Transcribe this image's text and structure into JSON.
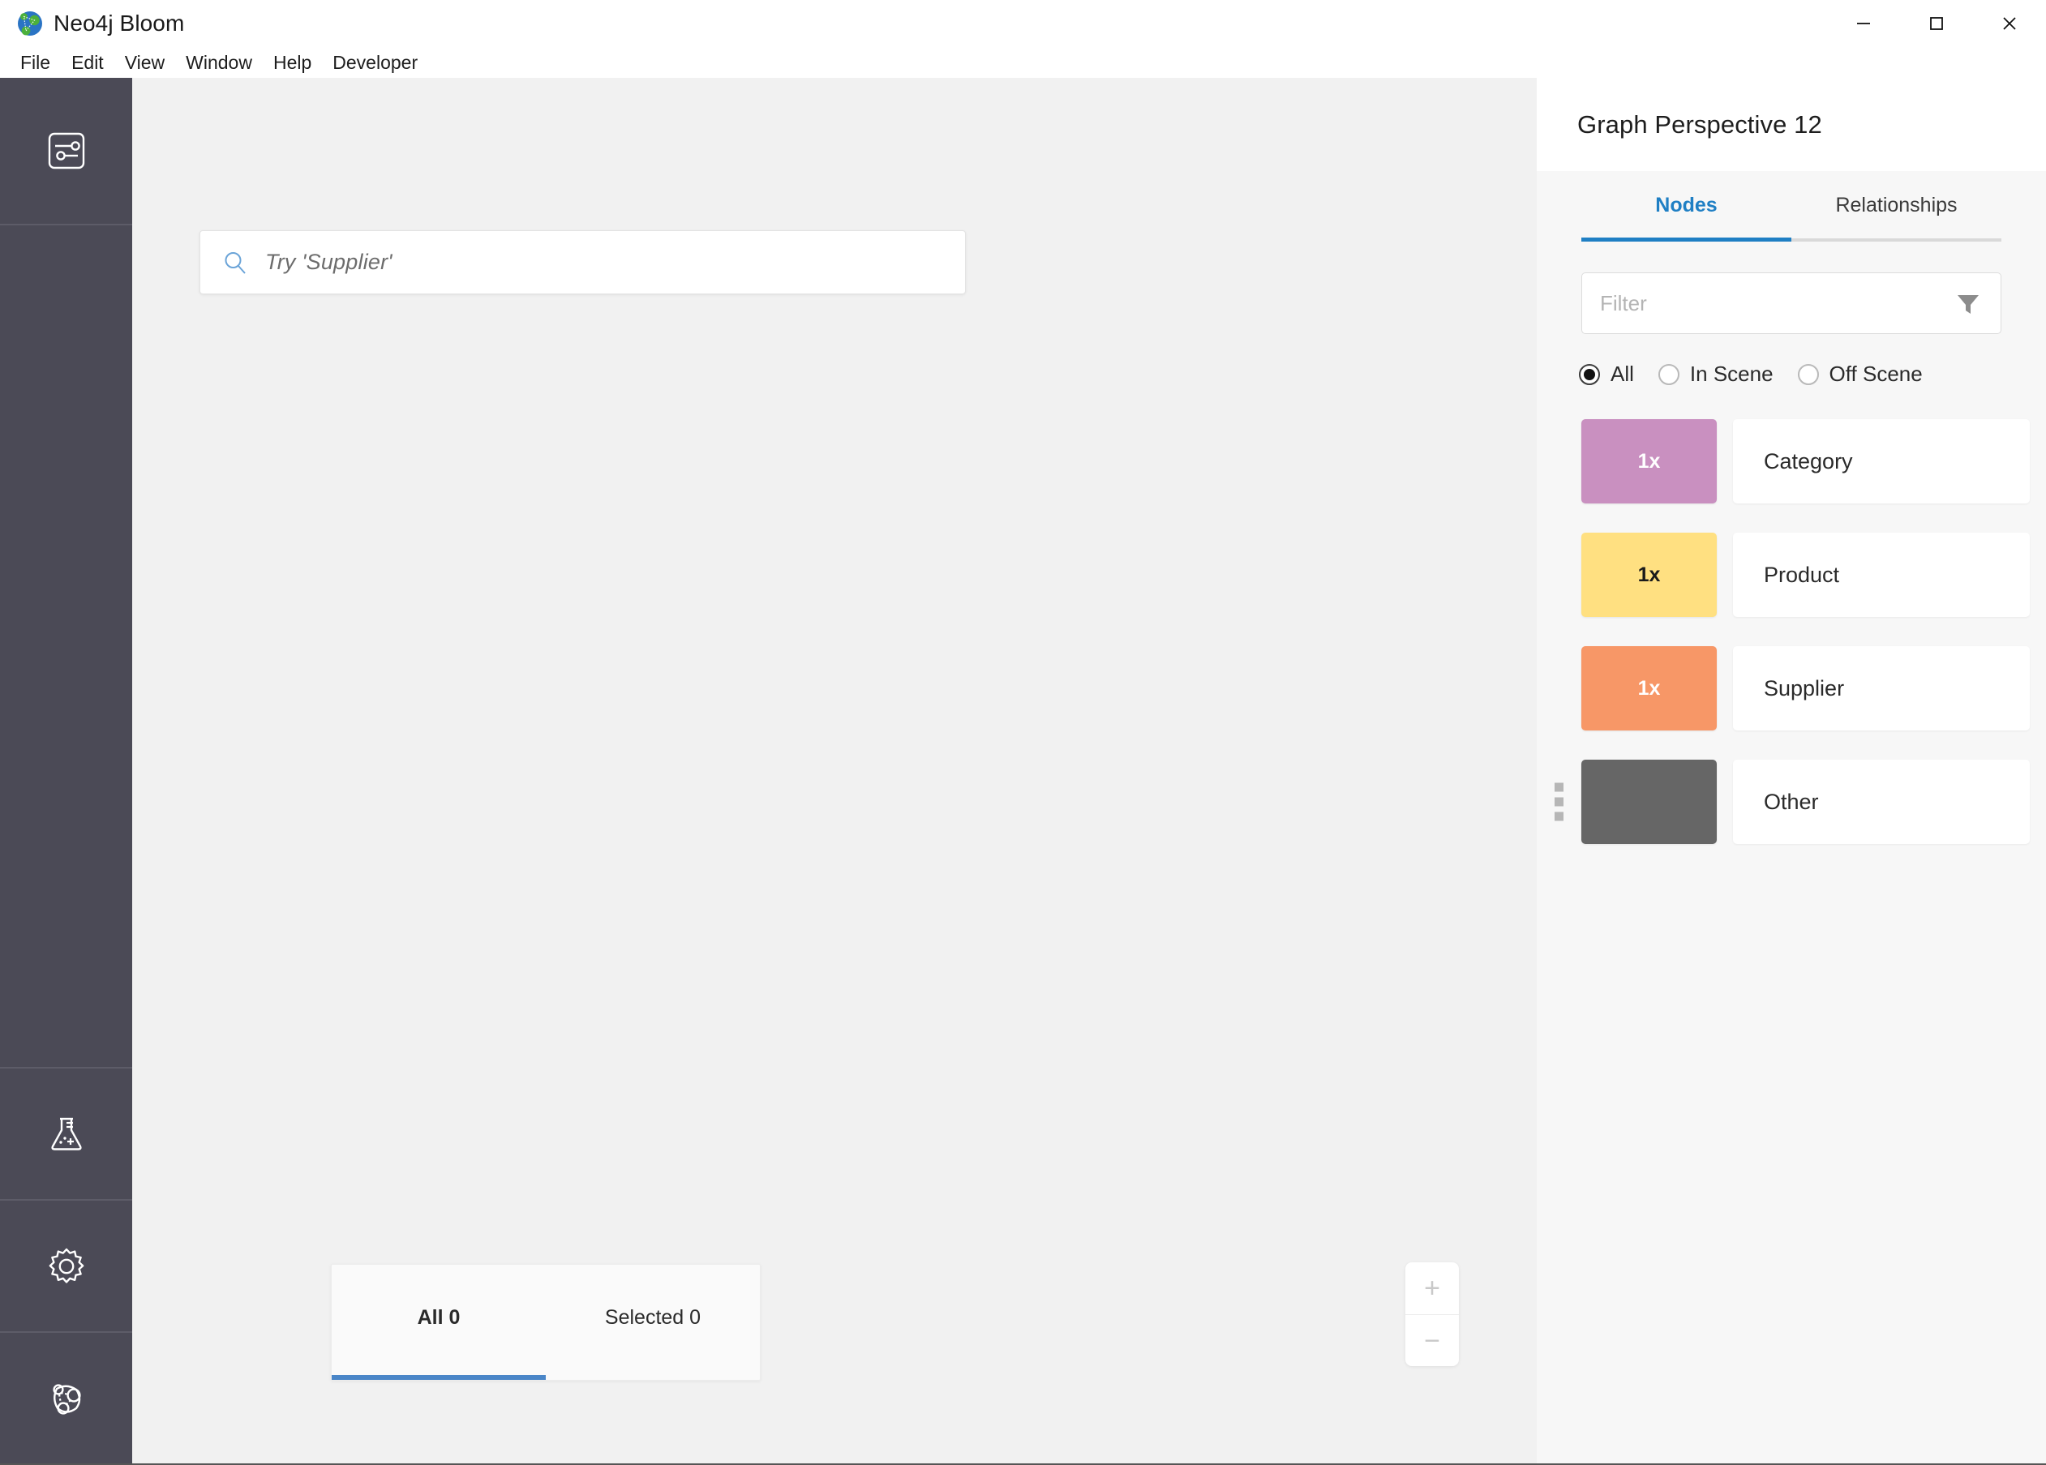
{
  "window": {
    "app_title": "Neo4j Bloom",
    "logo_icon": "neo4j-logo-icon",
    "controls": {
      "minimize": "minimize-icon",
      "maximize": "maximize-icon",
      "close": "close-icon"
    }
  },
  "menubar": {
    "items": [
      {
        "label": "File"
      },
      {
        "label": "Edit"
      },
      {
        "label": "View"
      },
      {
        "label": "Window"
      },
      {
        "label": "Help"
      },
      {
        "label": "Developer"
      }
    ]
  },
  "sidebar": {
    "items": [
      {
        "name": "perspective-sliders-icon",
        "icon": "sliders-icon"
      },
      {
        "name": "experiments-flask-icon",
        "icon": "flask-icon"
      },
      {
        "name": "settings-gear-icon",
        "icon": "gear-icon"
      },
      {
        "name": "graph-nodes-icon",
        "icon": "graph-icon"
      }
    ]
  },
  "canvas": {
    "search": {
      "icon": "search-icon",
      "placeholder": "Try 'Supplier'",
      "value": ""
    },
    "bottom_tabs": [
      {
        "label": "All 0",
        "active": true
      },
      {
        "label": "Selected 0",
        "active": false
      }
    ],
    "zoom_controls": {
      "zoom_in_label": "+",
      "zoom_out_label": "−"
    }
  },
  "panel": {
    "title": "Graph Perspective 12",
    "tabs": [
      {
        "label": "Nodes",
        "active": true
      },
      {
        "label": "Relationships",
        "active": false
      }
    ],
    "filter": {
      "placeholder": "Filter",
      "value": "",
      "icon": "funnel-icon"
    },
    "scope_radios": [
      {
        "label": "All",
        "checked": true
      },
      {
        "label": "In Scene",
        "checked": false
      },
      {
        "label": "Off Scene",
        "checked": false
      }
    ],
    "node_types": [
      {
        "count": "1x",
        "label": "Category",
        "color": "#C990C0",
        "count_color": "#ffffff"
      },
      {
        "count": "1x",
        "label": "Product",
        "color": "#FFE081",
        "count_color": "#1a1a1a"
      },
      {
        "count": "1x",
        "label": "Supplier",
        "color": "#F79767",
        "count_color": "#ffffff"
      },
      {
        "count": "",
        "label": "Other",
        "color": "#666666",
        "count_color": "#ffffff"
      }
    ]
  },
  "colors": {
    "accent_blue": "#1F7FC4",
    "tab_underline_blue": "#4A86C8",
    "sidebar_bg": "#4B4A56",
    "canvas_bg": "#F1F1F1",
    "panel_bg": "#F7F7F7"
  }
}
